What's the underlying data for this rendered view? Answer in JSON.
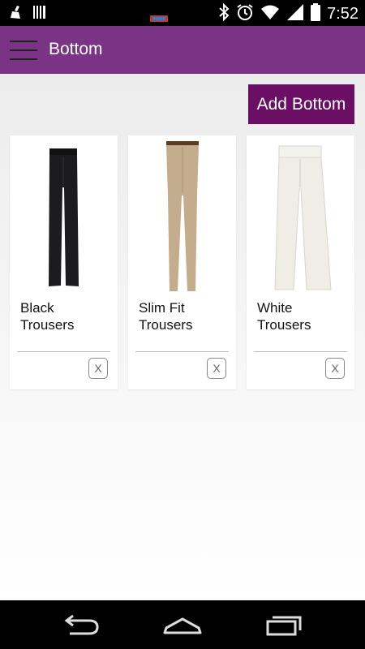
{
  "status_bar": {
    "time": "7:52"
  },
  "app_bar": {
    "title": "Bottom"
  },
  "toolbar": {
    "add_label": "Add Bottom"
  },
  "items": [
    {
      "name": "Black Trousers",
      "remove_label": "X"
    },
    {
      "name": "Slim Fit Trousers",
      "remove_label": "X"
    },
    {
      "name": "White Trousers",
      "remove_label": "X"
    }
  ],
  "icons": {
    "status": [
      "broom-icon",
      "barcode-icon",
      "battery-indicator-icon",
      "bluetooth-icon",
      "alarm-icon",
      "wifi-icon",
      "signal-icon",
      "battery-icon"
    ],
    "menu": "hamburger-menu-icon",
    "nav": [
      "back-icon",
      "home-icon",
      "recent-apps-icon"
    ]
  },
  "colors": {
    "app_bar": "#7b3385",
    "add_button": "#6a0f63",
    "black_trousers": "#1c1c1e",
    "slim_fit_trousers": "#c4ad8d",
    "white_trousers": "#efede6"
  }
}
